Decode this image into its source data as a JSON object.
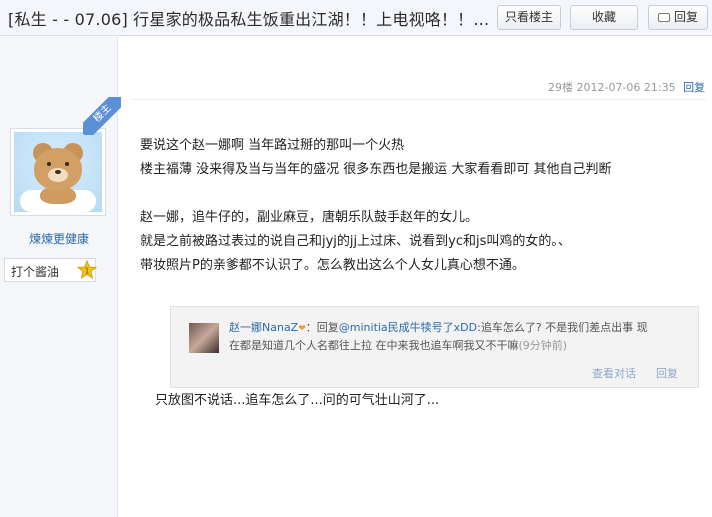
{
  "header": {
    "thread_title": "[私生 - - 07.06] 行星家的极品私生饭重出江湖！！上电视咯！！...",
    "only_op_label": "只看楼主",
    "favorite_label": "收藏",
    "reply_label": "回复"
  },
  "author": {
    "avatar": "bear-avatar",
    "username": "煉煉更健康",
    "rank_label": "打个酱油",
    "rank_level": "1",
    "badge_text": "楼主"
  },
  "post": {
    "floor": "29楼",
    "timestamp": "2012-07-06 21:35",
    "reply_link": "回复",
    "lines": [
      "要说这个赵一娜啊 当年路过掰的那叫一个火热",
      "楼主福薄 没来得及当与当年的盛况 很多东西也是搬运 大家看看即可 其他自己判断",
      "赵一娜，追牛仔的，副业麻豆，唐朝乐队鼓手赵年的女儿。",
      "就是之前被路过表过的说自己和jyj的jj上过床、说看到yc和js叫鸡的女的。、",
      "带妆照片P的亲爹都不认识了。怎么教出这么个人女儿真心想不通。"
    ],
    "caption": "只放图不说话...追车怎么了...问的可气壮山河了..."
  },
  "embedded_comment": {
    "name": "赵一娜NanaZ",
    "vip_mark": "❤",
    "reply_prefix": "：回复",
    "mention": "@minitia民成牛犊号了xDD",
    "text1": ":追车怎么了? 不是我们差点出事 现",
    "text2": "在都是知道几个人名都往上拉 在中来我也追车啊我又不干嘛",
    "time": "(9分钟前)",
    "view_chat": "查看对话",
    "reply": "回复"
  },
  "colors": {
    "link": "#2b6aa8",
    "ribbon": "#5b8fd6",
    "star": "#f0c419"
  }
}
